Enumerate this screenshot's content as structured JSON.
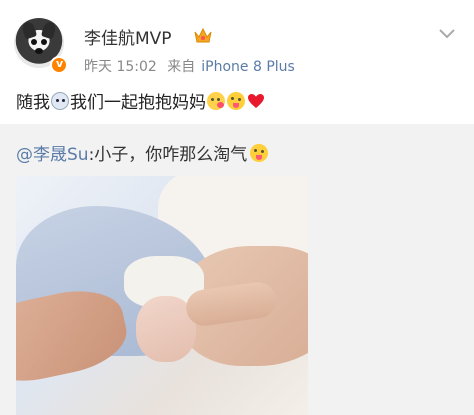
{
  "post": {
    "username": "李佳航MVP",
    "time": "昨天 15:02",
    "source_prefix": "来自",
    "source": "iPhone 8 Plus",
    "text_a": "随我",
    "text_b": "我们一起抱抱妈妈"
  },
  "repost": {
    "mention": "@李晟Su",
    "text": " :小子，你咋那么淘气"
  },
  "icons": {
    "vip_badge": "vip-v-icon",
    "crown": "crown-icon",
    "menu": "chevron-down-icon",
    "emoji_1": "doge-face-icon",
    "emoji_2": "kiss-face-icon",
    "emoji_3": "tongue-face-icon",
    "emoji_4": "heart-icon",
    "emoji_5": "tongue-face-icon"
  },
  "colors": {
    "link": "#5b7ca8",
    "badge": "#ff8200",
    "heart": "#e8192c"
  }
}
